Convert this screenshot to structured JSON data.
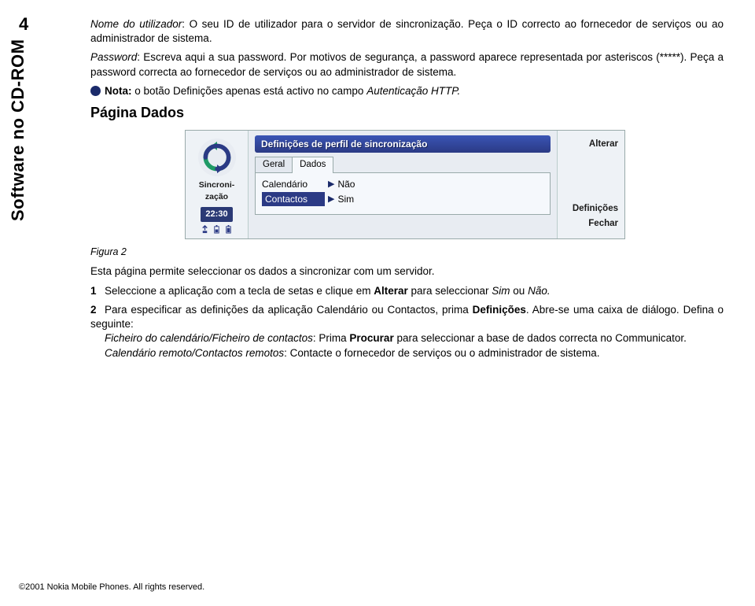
{
  "page_number": "4",
  "side_title": "Software no CD-ROM",
  "paras": {
    "p1_label": "Nome do utilizador",
    "p1_text": ": O seu ID de utilizador para o servidor de sincronização. Peça o ID correcto ao fornecedor de serviços ou ao administrador de sistema.",
    "p2_label": "Password",
    "p2_text": ": Escreva aqui a sua password. Por motivos de segurança, a password aparece representada por asteriscos (*****). Peça a password correcta ao fornecedor de serviços ou ao administrador de sistema.",
    "note_label": "Nota:",
    "note_text": " o botão Definições apenas está activo no campo ",
    "note_field": "Autenticação HTTP.",
    "h2": "Página Dados"
  },
  "screen": {
    "sync_label": "Sincroni-\nzação",
    "time": "22:30",
    "title": "Definições de perfil de sincronização",
    "tab_geral": "Geral",
    "tab_dados": "Dados",
    "row1_label": "Calendário",
    "row1_val": "Não",
    "row2_label": "Contactos",
    "row2_val": "Sim",
    "btn_alterar": "Alterar",
    "btn_def": "Definições",
    "btn_fechar": "Fechar"
  },
  "figura": "Figura 2",
  "body2": {
    "intro": "Esta página permite seleccionar os dados a sincronizar com um servidor.",
    "s1_num": "1",
    "s1a": "Seleccione a aplicação com a tecla de setas e clique em ",
    "s1b": "Alterar",
    "s1c": " para seleccionar ",
    "s1d": "Sim",
    "s1e": " ou ",
    "s1f": "Não.",
    "s2_num": "2",
    "s2a": "Para especificar as definições da aplicação Calendário ou Contactos, prima ",
    "s2b": "Definições",
    "s2c": ". Abre-se uma caixa de diálogo. Defina o seguinte:",
    "s2d_label": "Ficheiro do calendário/Ficheiro de contactos",
    "s2d_text": ": Prima ",
    "s2d_b": "Procurar",
    "s2d_text2": " para seleccionar a base de dados correcta no Communicator.",
    "s2e_label": "Calendário remoto/Contactos remotos",
    "s2e_text": ": Contacte o fornecedor de serviços ou o administrador de sistema."
  },
  "copyright": "©2001 Nokia Mobile Phones. All rights reserved."
}
